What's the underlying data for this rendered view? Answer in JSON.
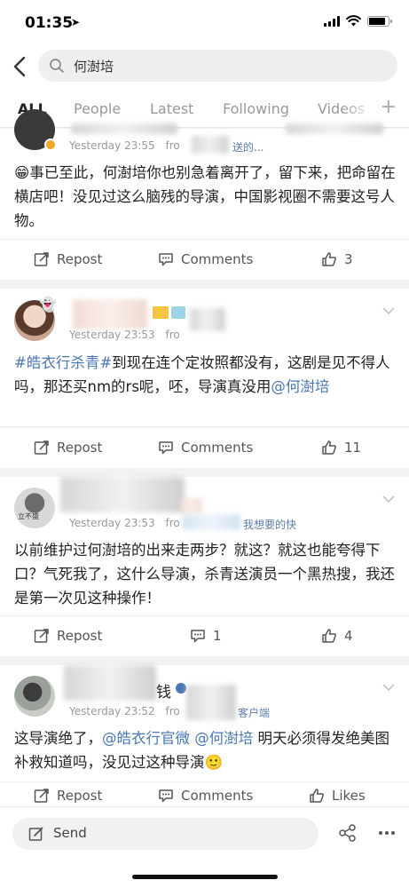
{
  "status_bar": {
    "time": "01:35",
    "battery_level": 0.85
  },
  "search": {
    "query": "何澍培"
  },
  "tabs": [
    "ALL",
    "People",
    "Latest",
    "Following",
    "Videos"
  ],
  "posts": [
    {
      "time": "Yesterday 23:55",
      "source_prefix": "fro",
      "source_tail": "送的...",
      "content_parts": [
        {
          "text": "事已至此，何澍培你也别急着离开了，留下来，把命留在横店吧！没见过这么脑残的导演，中国影视圈不需要这号人物。",
          "link": false
        }
      ],
      "repost_label": "Repost",
      "comment_label": "Comments",
      "like_label": "3"
    },
    {
      "time": "Yesterday 23:53",
      "source_prefix": "fro",
      "source_tail": "",
      "content_parts": [
        {
          "text": "#皓衣行杀青#",
          "link": true
        },
        {
          "text": "到现在连个定妆照都没有，这剧是见不得人吗，那还买nm的rs呢，呸，导演真没用",
          "link": false
        },
        {
          "text": "@何澍培",
          "link": true
        }
      ],
      "repost_label": "Repost",
      "comment_label": "Comments",
      "like_label": "11"
    },
    {
      "time": "Yesterday 23:53",
      "source_prefix": "fro",
      "source_tail": "我想要的快",
      "avatar_text": "立不盛",
      "content_parts": [
        {
          "text": "以前维护过何澍培的出来走两步？就这？就这也能夸得下口？气死我了，这什么导演，杀青送演员一个黑热搜，我还是第一次见这种操作！",
          "link": false
        }
      ],
      "repost_label": "Repost",
      "comment_label": "1",
      "like_label": "4"
    },
    {
      "time": "Yesterday 23:52",
      "source_prefix": "fro",
      "source_tail": "客户端",
      "name_tail": "钱",
      "content_parts": [
        {
          "text": "这导演绝了，",
          "link": false
        },
        {
          "text": "@皓衣行官微",
          "link": true
        },
        {
          "text": " ",
          "link": false
        },
        {
          "text": "@何澍培",
          "link": true
        },
        {
          "text": " 明天必须得发绝美图补救知道吗，没见过这种导演",
          "link": false
        },
        {
          "text": "🙂",
          "link": false
        }
      ],
      "repost_label": "Repost",
      "comment_label": "Comments",
      "like_label": "Likes"
    }
  ],
  "bottom_bar": {
    "send_label": "Send"
  }
}
